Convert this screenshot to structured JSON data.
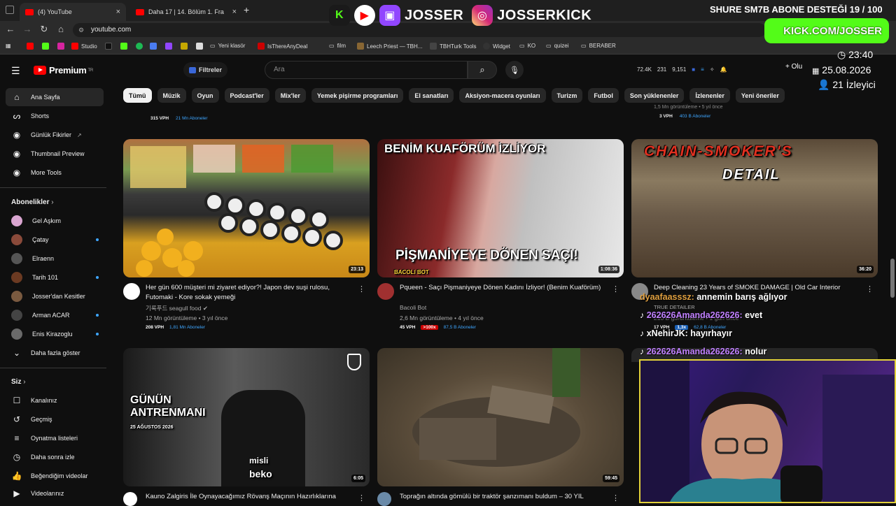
{
  "browser": {
    "tabs": [
      {
        "label": "(4) YouTube",
        "active": true
      },
      {
        "label": "Daha 17 | 14. Bölüm 1. Fragmanı",
        "active": false
      }
    ],
    "new_tab": "+",
    "url": "youtube.com",
    "bookmarks": [
      "Studio",
      "Yeni klasör",
      "IsThereAnyDeal",
      "film",
      "Leech Priest — TBH...",
      "TBHTurk Tools",
      "Widget",
      "KO",
      "quizei",
      "BERABER"
    ]
  },
  "stream_overlay": {
    "handle1": "JOSSER",
    "handle2": "JOSSERKICK",
    "donation_banner": "SHURE SM7B ABONE DESTEĞİ 19 / 100",
    "kick_url": "KICK.COM/JOSSER",
    "time": "23:40",
    "date": "25.08.2026",
    "viewers": "21 İzleyici",
    "chat": [
      {
        "user": "dyaafaasssz:",
        "message": "annemin barış ağlıyor",
        "user_color": "#e0a040"
      },
      {
        "user": "262626Amanda262626:",
        "message": "evet",
        "user_color": "#c080ff"
      },
      {
        "user": "xNehirJK:",
        "message": "hayırhayır",
        "user_color": "#ffffff"
      },
      {
        "user": "262626Amanda262626:",
        "message": "nolur",
        "user_color": "#c080ff"
      }
    ]
  },
  "youtube": {
    "logo": "Premium",
    "logo_region": "TR",
    "filters_label": "Filtreler",
    "search_placeholder": "Ara",
    "stats": [
      "72.4K",
      "231",
      "9,151"
    ],
    "create_label": "Olu",
    "sidebar": {
      "main": [
        "Ana Sayfa",
        "Shorts",
        "Günlük Fikirler",
        "Thumbnail Preview",
        "More Tools"
      ],
      "subscriptions_title": "Abonelikler",
      "subscriptions": [
        "Gel Aşkım",
        "Çatay",
        "Elraenn",
        "Tarih 101",
        "Josser'dan Kesitler",
        "Arman ACAR",
        "Enis Kirazoglu"
      ],
      "show_more": "Daha fazla göster",
      "you_title": "Siz",
      "you_items": [
        "Kanalınız",
        "Geçmiş",
        "Oynatma listeleri",
        "Daha sonra izle",
        "Beğendiğim videolar",
        "Videolarınız"
      ]
    },
    "chips": [
      "Tümü",
      "Müzik",
      "Oyun",
      "Podcast'ler",
      "Mix'ler",
      "Yemek pişirme programları",
      "El sanatları",
      "Aksiyon-macera oyunları",
      "Turizm",
      "Futbol",
      "Son yüklenenler",
      "İzlenenler",
      "Yeni öneriler"
    ],
    "top_partial": [
      {
        "vph": "315 VPH",
        "subs": "21 Mn Aboneler"
      },
      {
        "meta": "1,5 Mn görüntüleme • 5 yıl önce",
        "vph": "3 VPH",
        "subs": "403 B Aboneler"
      }
    ],
    "videos": [
      {
        "title": "Her gün 600 müşteri mi ziyaret ediyor?! Japon dev suşi rulosu, Futomaki - Kore sokak yemeği",
        "channel": "기록푸드 seagull food",
        "meta": "12 Mn görüntüleme • 3 yıl önce",
        "vph": "208 VPH",
        "subs": "1,81 Mn Aboneler",
        "duration": "23:13"
      },
      {
        "title": "Pqueen - Saçı Pişmaniyeye Dönen Kadını İzliyor! (Benim Kuaförüm)",
        "channel": "Bacoli Bot",
        "meta": "2,6 Mn görüntüleme • 4 yıl önce",
        "vph": "45 VPH",
        "badge": ">100x",
        "subs": "87,5 B Aboneler",
        "duration": "1:08:36",
        "thumb_top": "BENİM KUAFÖRÜM İZLİYOR",
        "thumb_bottom": "PİŞMANİYEYE DÖNEN SAÇI!",
        "thumb_tag": "BACOLI BOT"
      },
      {
        "title": "Deep Cleaning 23 Years of SMOKE DAMAGE | Old Car Interior",
        "channel": "TRUE DETAILER",
        "meta": "210 B görüntüleme • 1 gün önce",
        "vph": "17 VPH",
        "badge": "1,3x",
        "subs": "62,8 B Aboneler",
        "duration": "36:20",
        "thumb_top": "CHAIN-SMOKER'S",
        "thumb_bottom": "DETAIL"
      },
      {
        "title": "Kauno Zalgiris İle Oynayacağımız Rövanş Maçının Hazırlıklarına",
        "duration": "6:05",
        "thumb_top": "GÜNÜN",
        "thumb_mid": "ANTRENMANI",
        "thumb_date": "25 AĞUSTOS 2026",
        "jersey": "misli",
        "sponsor": "beko"
      },
      {
        "title": "Toprağın altında gömülü bir traktör şanzımanı buldum – 30 YIL",
        "duration": "59:45"
      }
    ]
  }
}
